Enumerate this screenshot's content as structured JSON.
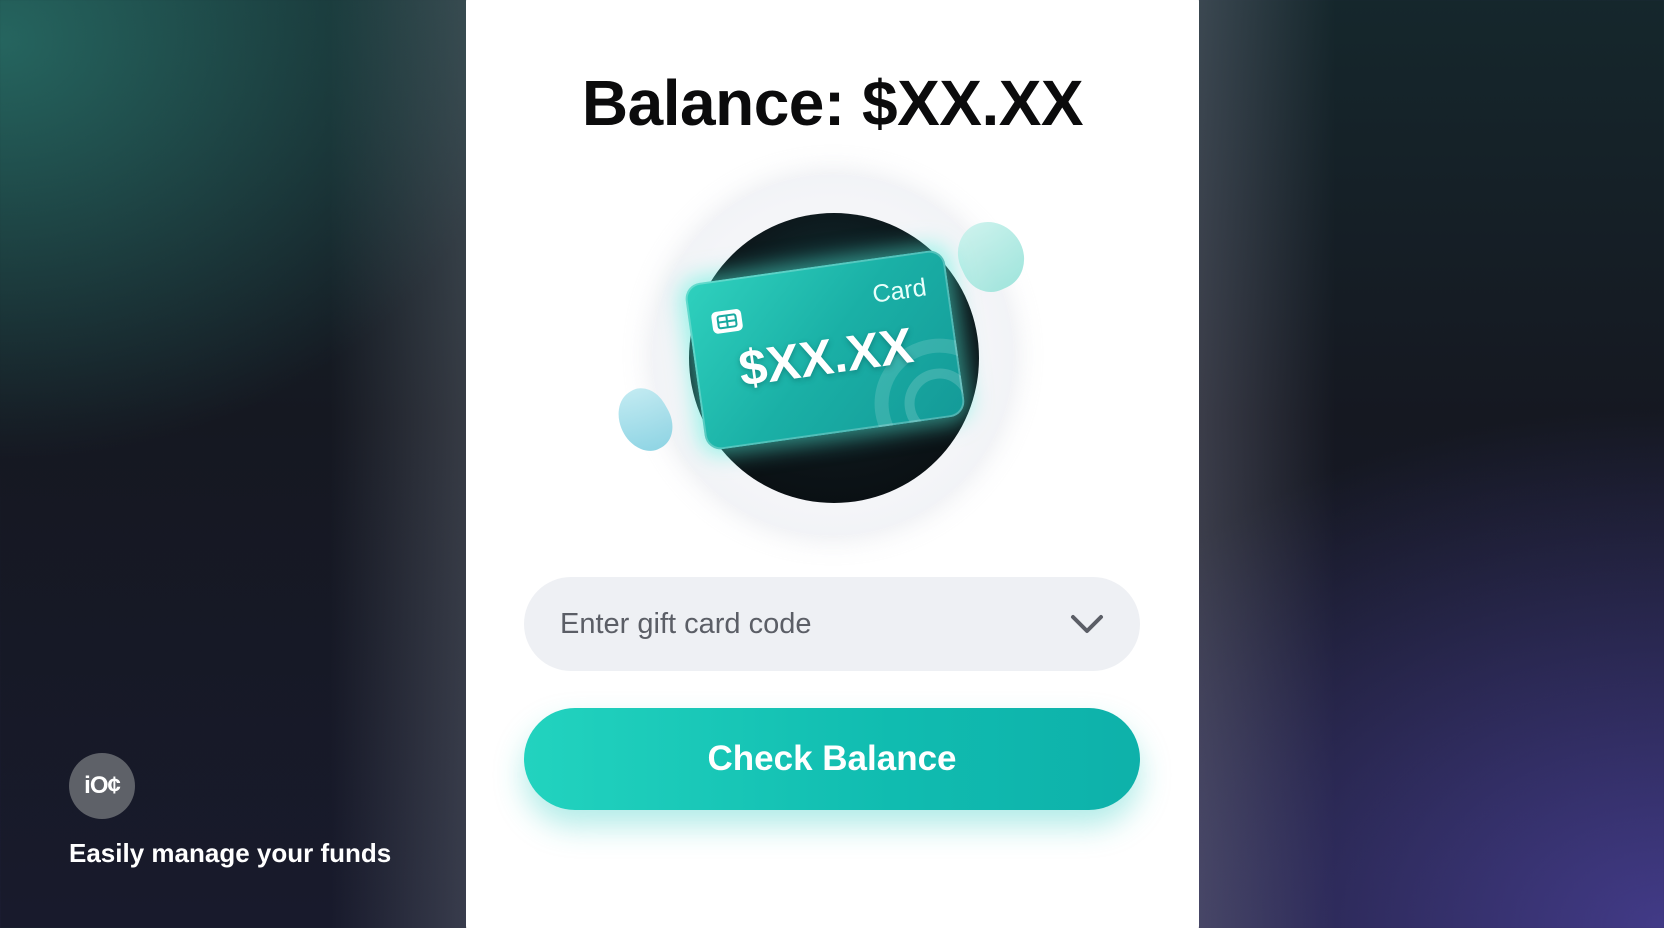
{
  "header": {
    "title": "Balance: $XX.XX"
  },
  "gift_card": {
    "label": "Card",
    "amount": "$XX.XX",
    "chip_icon": "chip-icon"
  },
  "form": {
    "code_placeholder": "Enter gift card code",
    "dropdown_icon": "chevron-down-icon",
    "check_button_label": "Check Balance"
  },
  "branding": {
    "badge_text": "iO¢",
    "tagline": "Easily manage your funds"
  },
  "colors": {
    "accent": "#1ec4b6",
    "panel": "#ffffff",
    "field": "#eef0f4",
    "title": "#0b0b0c"
  }
}
